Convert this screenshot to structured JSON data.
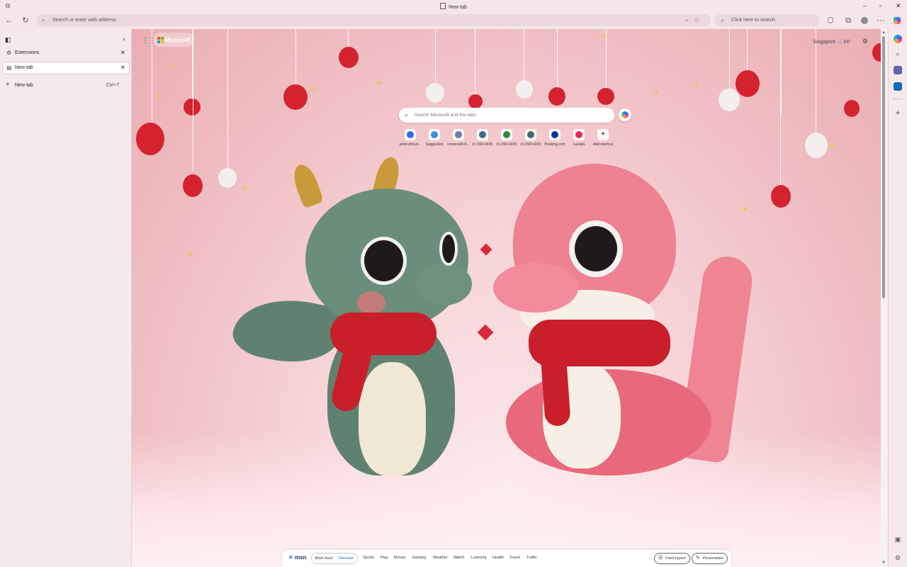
{
  "window": {
    "title": "New tab"
  },
  "toolbar": {
    "address_placeholder": "Search or enter web address",
    "search_placeholder": "Click here to search"
  },
  "vertical_tabs": {
    "items": [
      {
        "label": "Extensions"
      },
      {
        "label": "New tab"
      }
    ],
    "new_tab_label": "New tab",
    "new_tab_shortcut": "Ctrl+T"
  },
  "ntp": {
    "brand": "Microsoft",
    "weather_location": "Singapore",
    "weather_temp": "24°",
    "search_placeholder": "Search Microsoft and the web",
    "shortcuts": [
      {
        "label": "prod.uhm.pi...",
        "color": "#2f6fe4"
      },
      {
        "label": "Suggestion",
        "color": "#3a8fd8"
      },
      {
        "label": "cosmos06 A...",
        "color": "#6a7fa8"
      },
      {
        "label": "tn (300×300)",
        "color": "#3d6b8a"
      },
      {
        "label": "tn (300×300)",
        "color": "#2e8b3e"
      },
      {
        "label": "tn (300×300)",
        "color": "#3d6b6a"
      },
      {
        "label": "Booking.com",
        "color": "#003b95"
      },
      {
        "label": "Lazada",
        "color": "#e5294f"
      },
      {
        "label": "Add shortcut",
        "color": "#777777"
      }
    ]
  },
  "msn": {
    "logo": "msn",
    "tabs": [
      "Work feed",
      "Discover"
    ],
    "nav": [
      "Sports",
      "Play",
      "Money",
      "Gaming",
      "Weather",
      "Watch",
      "Learning",
      "Health",
      "Travel",
      "Traffic"
    ],
    "feed_layout": "Feed layout",
    "personalise": "Personalise"
  },
  "colors": {
    "accent": "#1a64d6",
    "heart": "#d8283a"
  }
}
